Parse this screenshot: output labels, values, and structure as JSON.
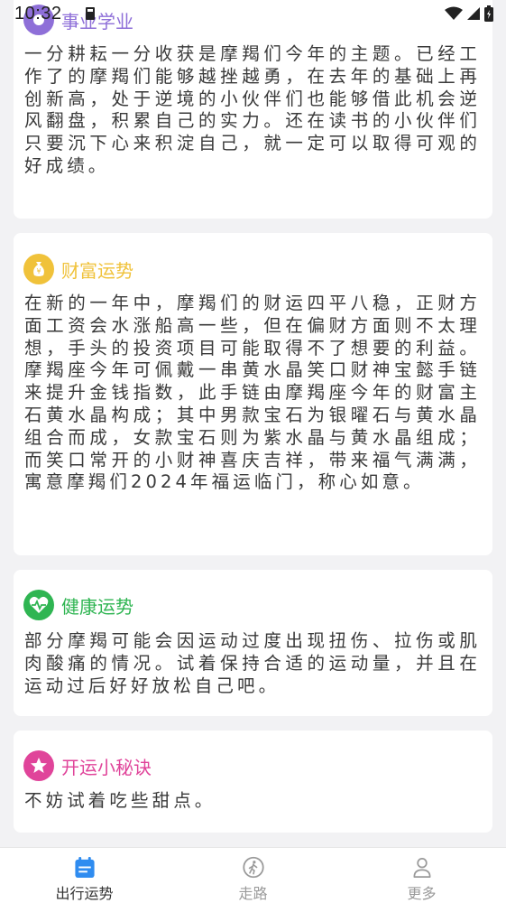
{
  "status_bar": {
    "time": "10:32"
  },
  "cards": {
    "career": {
      "title": "事业学业",
      "text": "一分耕耘一分收获是摩羯们今年的主题。已经工作了的摩羯们能够越挫越勇，在去年的基础上再创新高，处于逆境的小伙伴们也能够借此机会逆风翻盘，积累自己的实力。还在读书的小伙伴们只要沉下心来积淀自己，就一定可以取得可观的好成绩。",
      "color": "#8e6fd8"
    },
    "wealth": {
      "title": "财富运势",
      "text": "在新的一年中，摩羯们的财运四平八稳，正财方面工资会水涨船高一些，但在偏财方面则不太理想，手头的投资项目可能取得不了想要的利益。摩羯座今年可佩戴一串黄水晶笑口财神宝懿手链来提升金钱指数，此手链由摩羯座今年的财富主石黄水晶构成；其中男款宝石为银曜石与黄水晶组合而成，女款宝石则为紫水晶与黄水晶组成；而笑口常开的小财神喜庆吉祥，带来福气满满，寓意摩羯们2024年福运临门，称心如意。",
      "color": "#f0c23a"
    },
    "health": {
      "title": "健康运势",
      "text": "部分摩羯可能会因运动过度出现扭伤、拉伤或肌肉酸痛的情况。试着保持合适的运动量，并且在运动过后好好放松自己吧。",
      "color": "#2fb552"
    },
    "tips": {
      "title": "开运小秘诀",
      "text": "不妨试着吃些甜点。",
      "color": "#e0449a"
    }
  },
  "tabbar": {
    "tabs": [
      {
        "label": "出行运势",
        "active": true
      },
      {
        "label": "走路",
        "active": false
      },
      {
        "label": "更多",
        "active": false
      }
    ],
    "active_color": "#2f8cf0",
    "inactive_color": "#9a9a9a"
  }
}
